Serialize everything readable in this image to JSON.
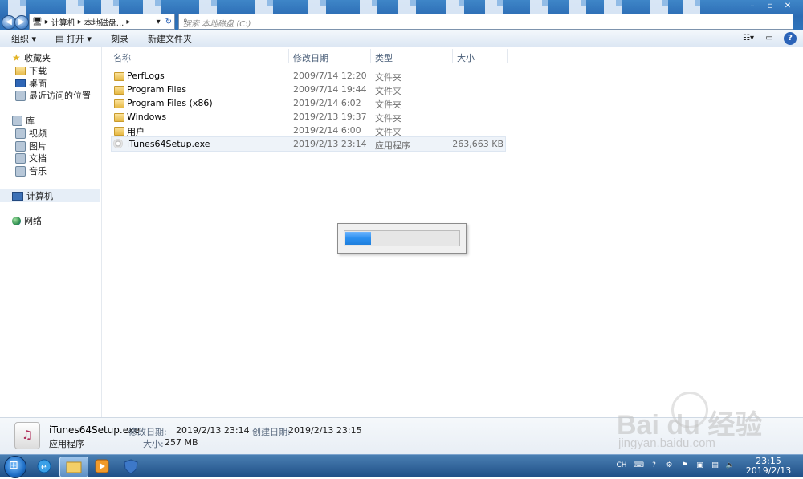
{
  "window": {
    "address_segments": [
      "计算机",
      "本地磁盘..."
    ],
    "search_placeholder": "搜索 本地磁盘 (C:)"
  },
  "toolbar": {
    "organize": "组织 ▾",
    "open": "打开 ▾",
    "burn": "刻录",
    "new_folder": "新建文件夹"
  },
  "nav": {
    "favorites": "收藏夹",
    "downloads": "下载",
    "desktop": "桌面",
    "recent": "最近访问的位置",
    "libraries": "库",
    "videos": "视频",
    "pictures": "图片",
    "documents": "文档",
    "music": "音乐",
    "computer": "计算机",
    "network": "网络"
  },
  "columns": {
    "name": "名称",
    "date": "修改日期",
    "type": "类型",
    "size": "大小"
  },
  "files": [
    {
      "name": "PerfLogs",
      "date": "2009/7/14 12:20",
      "type": "文件夹",
      "size": ""
    },
    {
      "name": "Program Files",
      "date": "2009/7/14 19:44",
      "type": "文件夹",
      "size": ""
    },
    {
      "name": "Program Files (x86)",
      "date": "2019/2/14 6:02",
      "type": "文件夹",
      "size": ""
    },
    {
      "name": "Windows",
      "date": "2019/2/13 19:37",
      "type": "文件夹",
      "size": ""
    },
    {
      "name": "用户",
      "date": "2019/2/14 6:00",
      "type": "文件夹",
      "size": ""
    },
    {
      "name": "iTunes64Setup.exe",
      "date": "2019/2/13 23:14",
      "type": "应用程序",
      "size": "263,663 KB"
    }
  ],
  "progress": {
    "fraction": 0.23
  },
  "details": {
    "filename": "iTunes64Setup.exe",
    "filetype": "应用程序",
    "modified_label": "修改日期:",
    "modified_value": "2019/2/13 23:14",
    "size_label": "大小:",
    "size_value": "257 MB",
    "created_label": "创建日期:",
    "created_value": "2019/2/13 23:15"
  },
  "taskbar": {
    "ime": "CH",
    "time": "23:15",
    "date": "2019/2/13"
  },
  "watermark": {
    "brand": "Bai du 经验",
    "url": "jingyan.baidu.com"
  }
}
